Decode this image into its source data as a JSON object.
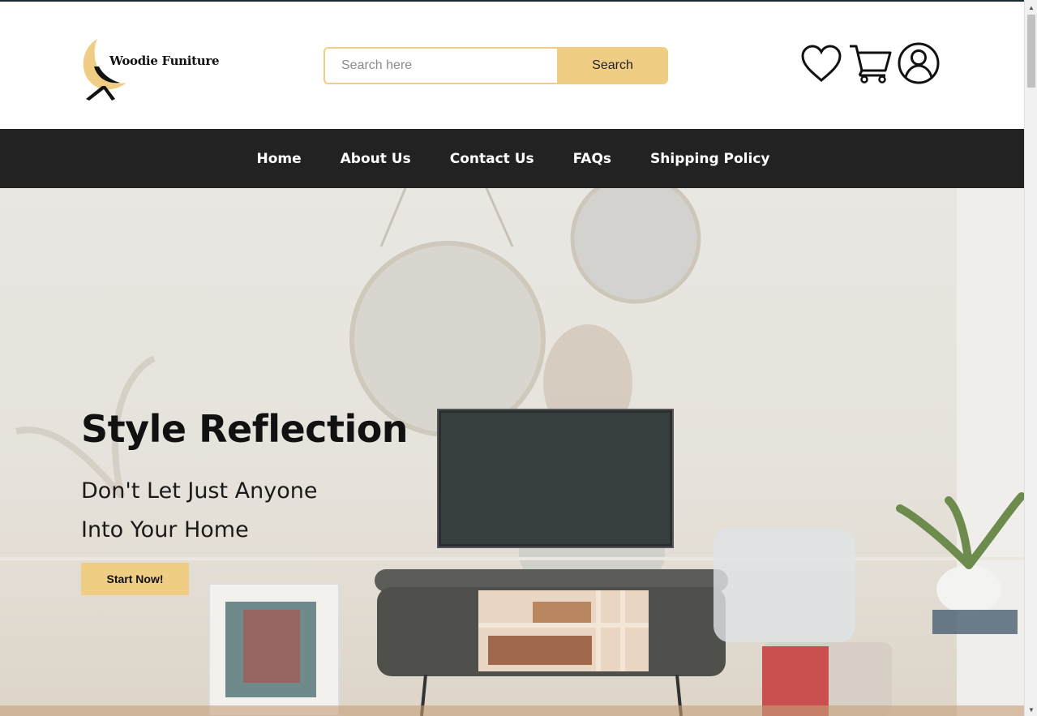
{
  "brand": {
    "name": "Woodie Funiture",
    "accent": "#f0cd85",
    "nav_bg": "#222222"
  },
  "search": {
    "placeholder": "Search here",
    "button_label": "Search"
  },
  "header_icons": [
    "heart-icon",
    "cart-icon",
    "user-icon"
  ],
  "nav": {
    "items": [
      {
        "label": "Home"
      },
      {
        "label": "About Us"
      },
      {
        "label": "Contact Us"
      },
      {
        "label": "FAQs"
      },
      {
        "label": "Shipping Policy"
      }
    ]
  },
  "hero": {
    "title": "Style Reflection",
    "line1": "Don't Let Just Anyone",
    "line2": "Into Your Home",
    "cta_label": "Start Now!"
  }
}
